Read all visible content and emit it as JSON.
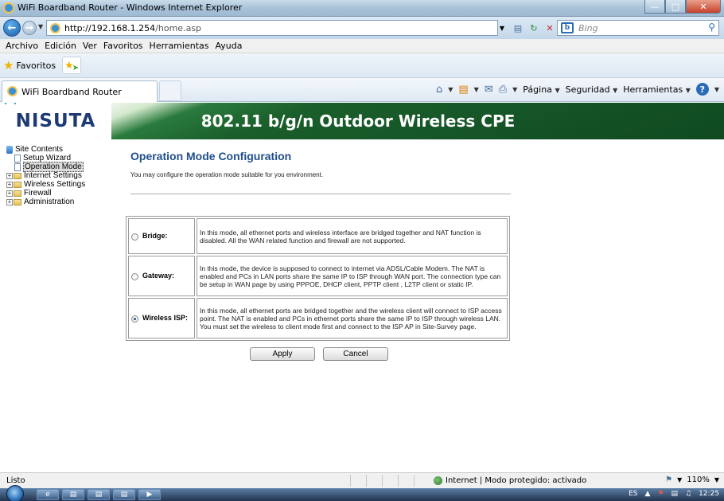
{
  "window": {
    "title": "WiFi Boardband Router - Windows Internet Explorer"
  },
  "address_bar": {
    "url_domain": "http://192.168.1.254",
    "url_path": "/home.asp",
    "search_placeholder": "Bing"
  },
  "menu": {
    "items": [
      "Archivo",
      "Edición",
      "Ver",
      "Favoritos",
      "Herramientas",
      "Ayuda"
    ]
  },
  "favorites_bar": {
    "favorites_label": "Favoritos"
  },
  "tab": {
    "title": "WiFi Boardband Router"
  },
  "command_bar": {
    "pagina": "Página",
    "seguridad": "Seguridad",
    "herramientas": "Herramientas"
  },
  "banner": {
    "logo": "NISUTA",
    "product": "802.11 b/g/n Outdoor Wireless CPE"
  },
  "tree": {
    "root": "Site Contents",
    "items": [
      "Setup Wizard",
      "Operation Mode"
    ],
    "folders": [
      "Internet Settings",
      "Wireless Settings",
      "Firewall",
      "Administration"
    ]
  },
  "main": {
    "title": "Operation Mode Configuration",
    "description": "You may configure the operation mode suitable for you environment.",
    "modes": [
      {
        "label": "Bridge:",
        "selected": false,
        "text": "In this mode, all ethernet ports and wireless interface are bridged together and NAT function is disabled. All the WAN related function and firewall are not supported."
      },
      {
        "label": "Gateway:",
        "selected": false,
        "text": "In this mode, the device is supposed to connect to internet via ADSL/Cable Modem. The NAT is enabled and PCs in LAN ports share the same IP to ISP through WAN port. The connection type can be setup in WAN page by using PPPOE, DHCP client, PPTP client , L2TP client or static IP."
      },
      {
        "label": "Wireless ISP:",
        "selected": true,
        "text": "In this mode, all ethernet ports are bridged together and the wireless client will connect to ISP access point. The NAT is enabled and PCs in ethernet ports share the same IP to ISP through wireless LAN. You must set the wireless to client mode first and connect to the ISP AP in Site-Survey page."
      }
    ],
    "apply_label": "Apply",
    "cancel_label": "Cancel"
  },
  "status_bar": {
    "status": "Listo",
    "zone": "Internet | Modo protegido: activado",
    "zoom": "110%"
  },
  "taskbar": {
    "language": "ES",
    "time": "12:25"
  }
}
